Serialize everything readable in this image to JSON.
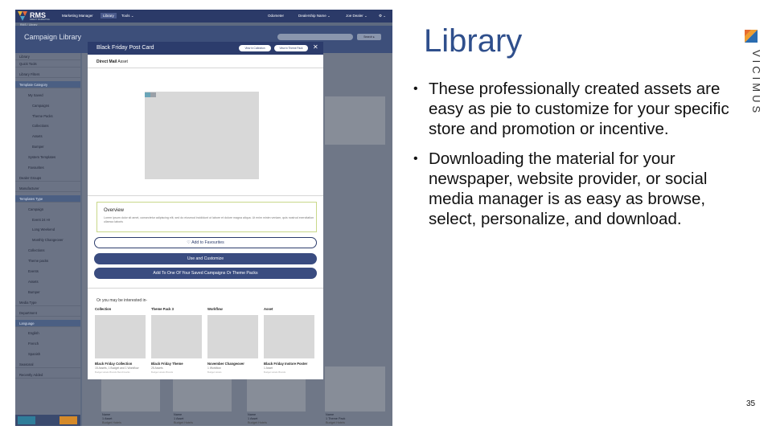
{
  "app": {
    "brand": "RMS",
    "brand_sub": "DIRECT MARKETING",
    "nav": [
      "Marketing Manager",
      "Library",
      "Tools ⌄"
    ],
    "nav_right": [
      "Odometer",
      "Dealership Name ⌄",
      "Joe Dealer ⌄",
      "⚙ ⌄"
    ],
    "breadcrumb": "RMS / Library",
    "page_title": "Campaign Library",
    "search_button": "Search ▸"
  },
  "sidebar": {
    "header": "Library",
    "items": [
      {
        "label": "Quick Tools",
        "level": 0,
        "hl": false
      },
      {
        "label": "Library Filters",
        "level": 0,
        "hl": false
      },
      {
        "label": "Template Category",
        "level": 0,
        "hl": true
      },
      {
        "label": "My Saved",
        "level": 1,
        "hl": false
      },
      {
        "label": "Campaigns",
        "level": 2,
        "hl": false
      },
      {
        "label": "Theme Packs",
        "level": 2,
        "hl": false
      },
      {
        "label": "Collections",
        "level": 2,
        "hl": false
      },
      {
        "label": "Assets",
        "level": 2,
        "hl": false
      },
      {
        "label": "Bumper",
        "level": 2,
        "hl": false
      },
      {
        "label": "System Templates",
        "level": 1,
        "hl": false
      },
      {
        "label": "Favourites",
        "level": 1,
        "hl": false
      },
      {
        "label": "Dealer Groups",
        "level": 0,
        "hl": false
      },
      {
        "label": "Manufacturer",
        "level": 0,
        "hl": false
      },
      {
        "label": "Templates Type",
        "level": 0,
        "hl": true
      },
      {
        "label": "Campaign",
        "level": 1,
        "hl": false
      },
      {
        "label": "Event 24 Hr",
        "level": 2,
        "hl": false
      },
      {
        "label": "Long Weekend",
        "level": 2,
        "hl": false
      },
      {
        "label": "Monthly Changeover",
        "level": 2,
        "hl": false
      },
      {
        "label": "Collections",
        "level": 1,
        "hl": false
      },
      {
        "label": "Theme packs",
        "level": 1,
        "hl": false
      },
      {
        "label": "Events",
        "level": 1,
        "hl": false
      },
      {
        "label": "Assets",
        "level": 1,
        "hl": false
      },
      {
        "label": "Bumper",
        "level": 1,
        "hl": false
      },
      {
        "label": "Media Type",
        "level": 0,
        "hl": false
      },
      {
        "label": "Department",
        "level": 0,
        "hl": false
      },
      {
        "label": "Language",
        "level": 0,
        "hl": true
      },
      {
        "label": "English",
        "level": 1,
        "hl": false
      },
      {
        "label": "French",
        "level": 1,
        "hl": false
      },
      {
        "label": "Spanish",
        "level": 1,
        "hl": false
      },
      {
        "label": "Seasonal",
        "level": 0,
        "hl": false
      },
      {
        "label": "Recently Added",
        "level": 0,
        "hl": false
      }
    ]
  },
  "background_cards": [
    {
      "name": "Name",
      "meta": "1 Asset",
      "meta2": "Budget Hotels"
    },
    {
      "name": "Name",
      "meta": "1 Asset",
      "meta2": "Budget Hotels"
    },
    {
      "name": "Name",
      "meta": "1 Asset",
      "meta2": "Budget Hotels"
    },
    {
      "name": "Name",
      "meta": "1 Theme Pack",
      "meta2": "Budget Hotels"
    }
  ],
  "modal": {
    "title": "Black Friday Post Card",
    "pill_view": "View in Collection",
    "pill_theme": "View in Theme Pack",
    "close": "✕",
    "subtitle_bold": "Direct Mail",
    "subtitle_rest": " Asset",
    "overview_heading": "Overview",
    "overview_text": "Lorem ipsum dolor sit amet, consectetur adipiscing elit, sed do eiusmod incididunt ut labore et dolore magna aliqua. Ut enim minim veniam, quis nostrud exercitation ullamco laboris",
    "btn_favourite": "♡ Add to Favourites",
    "btn_customize": "Use and Customize",
    "btn_add": "Add To One Of Your Saved Campaigns Or Theme Packs",
    "interest_label": "Or you may be interested in-",
    "suggestions": [
      {
        "type": "Collection",
        "name": "Black Friday Collection",
        "desc": "15 Assets, 1 Budget and 1 Workflow",
        "credit": "Budget Hotels Brands Benchmarks"
      },
      {
        "type": "Theme Pack 3",
        "name": "Black Friday Theme",
        "desc": "25 Assets",
        "credit": "Budget Hotels Brands"
      },
      {
        "type": "Workflow",
        "name": "November Changeover",
        "desc": "1 Workflow",
        "credit": "Budget Hotels"
      },
      {
        "type": "Asset",
        "name": "Black Friday Instore Poster",
        "desc": "1 Asset",
        "credit": "Budget Hotels Brands"
      }
    ]
  },
  "slide": {
    "heading": "Library",
    "bullets": [
      "These professionally created assets are easy as pie to customize for your specific store and promotion or incentive.",
      "Downloading the material for your newspaper, website provider, or social media manager is as easy as browse, select, personalize, and download."
    ],
    "logo_text": "VICIMUS",
    "page_number": "35"
  }
}
